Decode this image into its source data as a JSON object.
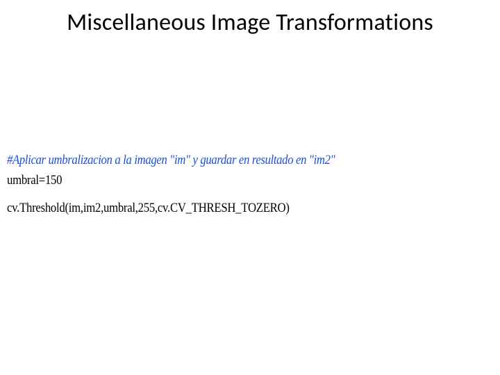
{
  "slide": {
    "title": "Miscellaneous Image Transformations"
  },
  "code": {
    "comment": "#Aplicar umbralizacion a la imagen \"im\" y guardar en resultado en \"im2\"",
    "assign": "umbral=150",
    "call": "cv.Threshold(im,im2,umbral,255,cv.CV_THRESH_TOZERO)"
  }
}
